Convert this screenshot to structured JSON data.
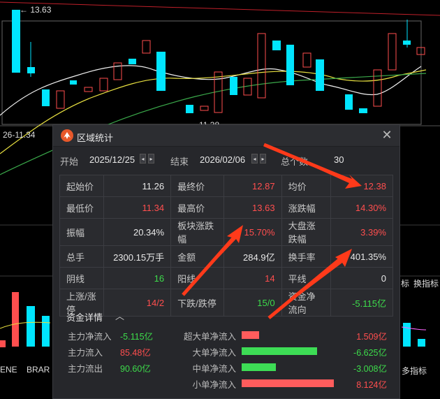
{
  "chart": {
    "high_marker": "13.63",
    "range_text": "26-11.34",
    "low_marker": "11.38",
    "indicator_tabs": [
      "ENE",
      "BRAR"
    ],
    "right_labels": [
      "标",
      "换指标",
      "多指标"
    ]
  },
  "dialog": {
    "title": "区域统计",
    "close_symbol": "✕",
    "start_label": "开始",
    "start_date": "2025/12/25",
    "end_label": "结束",
    "end_date": "2026/02/06",
    "count_label": "总个数",
    "count_value": "30",
    "stats": [
      [
        {
          "label": "起始价",
          "value": "11.26",
          "color": "wht"
        },
        {
          "label": "最终价",
          "value": "12.87",
          "color": "red"
        },
        {
          "label": "均价",
          "value": "12.38",
          "color": "red"
        }
      ],
      [
        {
          "label": "最低价",
          "value": "11.34",
          "color": "red"
        },
        {
          "label": "最高价",
          "value": "13.63",
          "color": "red"
        },
        {
          "label": "涨跌幅",
          "value": "14.30%",
          "color": "red"
        }
      ],
      [
        {
          "label": "振幅",
          "value": "20.34%",
          "color": "wht"
        },
        {
          "label": "板块涨跌幅",
          "value": "15.70%",
          "color": "red"
        },
        {
          "label": "大盘涨跌幅",
          "value": "3.39%",
          "color": "red"
        }
      ],
      [
        {
          "label": "总手",
          "value": "2300.15万手",
          "color": "wht"
        },
        {
          "label": "金额",
          "value": "284.9亿",
          "color": "wht"
        },
        {
          "label": "换手率",
          "value": "401.35%",
          "color": "wht"
        }
      ],
      [
        {
          "label": "阴线",
          "value": "16",
          "color": "grn"
        },
        {
          "label": "阳线",
          "value": "14",
          "color": "red"
        },
        {
          "label": "平线",
          "value": "0",
          "color": "wht"
        }
      ],
      [
        {
          "label": "上涨/涨停",
          "value": "14/2",
          "color": "red"
        },
        {
          "label": "下跌/跌停",
          "value": "15/0",
          "color": "grn"
        },
        {
          "label": "资金净流向",
          "value": "-5.115亿",
          "color": "grn"
        }
      ]
    ],
    "fund_title": "资金详情",
    "fund_toggle": "︿",
    "fund_left": [
      {
        "label": "主力净流入",
        "value": "-5.115亿",
        "color": "grn"
      },
      {
        "label": "主力流入",
        "value": "85.48亿",
        "color": "red"
      },
      {
        "label": "主力流出",
        "value": "90.60亿",
        "color": "grn"
      }
    ],
    "fund_right": [
      {
        "label": "超大单净流入",
        "value": "1.509亿",
        "color": "red",
        "bar": 0.186,
        "bar_color": "#ff5c5c"
      },
      {
        "label": "大单净流入",
        "value": "-6.625亿",
        "color": "grn",
        "bar": 0.816,
        "bar_color": "#3ddc55"
      },
      {
        "label": "中单净流入",
        "value": "-3.008亿",
        "color": "grn",
        "bar": 0.37,
        "bar_color": "#3ddc55"
      },
      {
        "label": "小单净流入",
        "value": "8.124亿",
        "color": "red",
        "bar": 1.0,
        "bar_color": "#ff5c5c"
      }
    ]
  },
  "colors": {
    "up": "#ff4e4e",
    "down": "#00e5ff",
    "annotation": "#ff3a1a"
  }
}
